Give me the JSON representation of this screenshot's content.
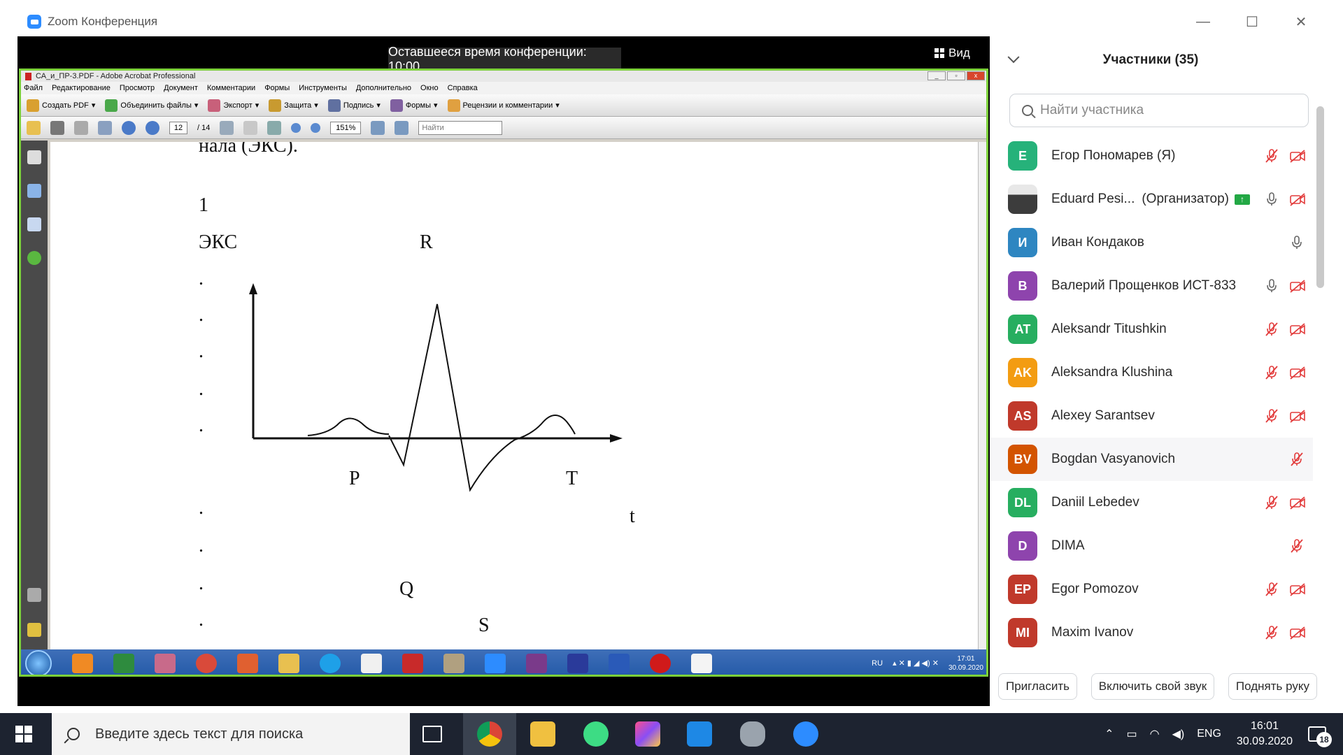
{
  "zoom": {
    "window_title": "Zoom Конференция",
    "remaining_time": "Оставшееся время конференции: 10:00",
    "view_label": "Вид",
    "controls": [
      "—",
      "☐",
      "✕"
    ]
  },
  "acrobat": {
    "title": "СА_и_ПР-3.PDF - Adobe Acrobat Professional",
    "menu": [
      "Файл",
      "Редактирование",
      "Просмотр",
      "Документ",
      "Комментарии",
      "Формы",
      "Инструменты",
      "Дополнительно",
      "Окно",
      "Справка"
    ],
    "toolbar": [
      "Создать PDF",
      "Объединить файлы",
      "Экспорт",
      "Защита",
      "Подпись",
      "Формы",
      "Рецензии и комментарии"
    ],
    "page_current": "12",
    "page_total": "/ 14",
    "zoom": "151%",
    "find_placeholder": "Найти",
    "doc": {
      "top_text": "нала (ЭКС).",
      "num": "1",
      "eks": "ЭКС",
      "r": "R",
      "p": "P",
      "t_label": "T",
      "t_axis": "t",
      "q": "Q",
      "s": "S",
      "dot": "."
    },
    "taskbar": {
      "lang": "RU",
      "time": "17:01",
      "date": "30.09.2020"
    }
  },
  "participants": {
    "title": "Участники (35)",
    "search_placeholder": "Найти участника",
    "items": [
      {
        "initials": "E",
        "name": "Егор Пономарев (Я)",
        "color": "#26b27a",
        "mic": "muted",
        "cam": "off"
      },
      {
        "initials": "",
        "name": "Eduard Pesi...",
        "role": "(Организатор)",
        "color": "#555555",
        "mic": "on",
        "cam": "off",
        "sharing": true
      },
      {
        "initials": "И",
        "name": "Иван Кондаков",
        "color": "#2e86c1",
        "mic": "on",
        "cam": "none"
      },
      {
        "initials": "В",
        "name": "Валерий Прощенков ИСТ-833",
        "color": "#8e44ad",
        "mic": "on",
        "cam": "off"
      },
      {
        "initials": "AT",
        "name": "Aleksandr Titushkin",
        "color": "#27ae60",
        "mic": "muted",
        "cam": "off"
      },
      {
        "initials": "AK",
        "name": "Aleksandra Klushina",
        "color": "#f39c12",
        "mic": "muted",
        "cam": "off"
      },
      {
        "initials": "AS",
        "name": "Alexey Sarantsev",
        "color": "#c0392b",
        "mic": "muted",
        "cam": "off"
      },
      {
        "initials": "BV",
        "name": "Bogdan Vasyanovich",
        "color": "#d35400",
        "mic": "muted",
        "cam": "none"
      },
      {
        "initials": "DL",
        "name": "Daniil Lebedev",
        "color": "#27ae60",
        "mic": "muted",
        "cam": "off"
      },
      {
        "initials": "D",
        "name": "DIMA",
        "color": "#8e44ad",
        "mic": "muted",
        "cam": "none"
      },
      {
        "initials": "EP",
        "name": "Egor Pomozov",
        "color": "#c0392b",
        "mic": "muted",
        "cam": "off"
      },
      {
        "initials": "MI",
        "name": "Maxim Ivanov",
        "color": "#c0392b",
        "mic": "muted",
        "cam": "off"
      }
    ],
    "footer": [
      "Пригласить",
      "Включить свой звук",
      "Поднять руку"
    ]
  },
  "taskbar": {
    "search_placeholder": "Введите здесь текст для поиска",
    "lang": "ENG",
    "time": "16:01",
    "date": "30.09.2020",
    "notifications": "18"
  }
}
